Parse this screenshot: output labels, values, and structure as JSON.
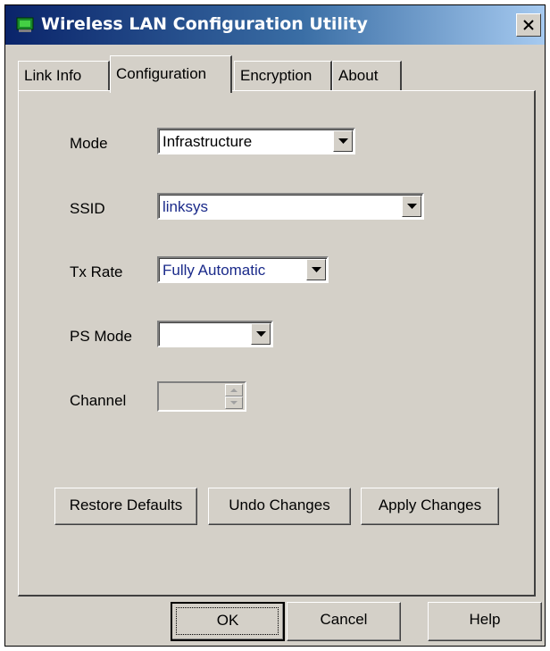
{
  "window": {
    "title": "Wireless LAN Configuration Utility",
    "close_glyph": "✕"
  },
  "tabs": [
    {
      "label": "Link Info",
      "active": false
    },
    {
      "label": "Configuration",
      "active": true
    },
    {
      "label": "Encryption",
      "active": false
    },
    {
      "label": "About",
      "active": false
    }
  ],
  "form": {
    "mode": {
      "label": "Mode",
      "value": "Infrastructure"
    },
    "ssid": {
      "label": "SSID",
      "value": "linksys"
    },
    "tx_rate": {
      "label": "Tx Rate",
      "value": "Fully Automatic"
    },
    "ps_mode": {
      "label": "PS Mode",
      "value": ""
    },
    "channel": {
      "label": "Channel",
      "value": ""
    }
  },
  "panel_buttons": {
    "restore": "Restore Defaults",
    "undo": "Undo Changes",
    "apply": "Apply Changes"
  },
  "dialog_buttons": {
    "ok": "OK",
    "cancel": "Cancel",
    "help": "Help"
  },
  "colors": {
    "title_start": "#0a246a",
    "title_end": "#a6caf0",
    "face": "#d4d0c8",
    "value_text_blue": "#1a2a8a"
  },
  "icons": {
    "app": "network-card-icon",
    "close": "close-icon",
    "dropdown": "chevron-down-icon",
    "spin_up": "spin-up-icon",
    "spin_down": "spin-down-icon"
  }
}
